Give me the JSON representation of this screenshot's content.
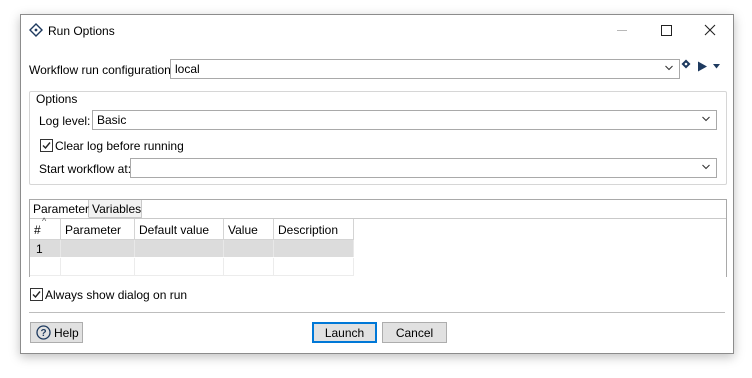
{
  "window": {
    "title": "Run Options",
    "icon": "diamond-icon"
  },
  "workflow_config": {
    "label": "Workflow run configuration",
    "value": "local"
  },
  "options": {
    "group_label": "Options",
    "log_level_label": "Log level:",
    "log_level_value": "Basic",
    "clear_log_label": "Clear log before running",
    "clear_log_checked": true,
    "start_at_label": "Start workflow at:",
    "start_at_value": ""
  },
  "tabs": [
    {
      "label": "Parameters",
      "active": true
    },
    {
      "label": "Variables",
      "active": false
    }
  ],
  "table": {
    "sort_indicator": "^",
    "columns": [
      "#",
      "Parameter",
      "Default value",
      "Value",
      "Description"
    ],
    "rows": [
      {
        "num": "1",
        "parameter": "",
        "default_value": "",
        "value": "",
        "description": ""
      }
    ]
  },
  "always_show": {
    "label": "Always show dialog on run",
    "checked": true
  },
  "buttons": {
    "help": "Help",
    "launch": "Launch",
    "cancel": "Cancel"
  },
  "colors": {
    "accent": "#0078d7",
    "icon_dark": "#1e3a5f"
  }
}
